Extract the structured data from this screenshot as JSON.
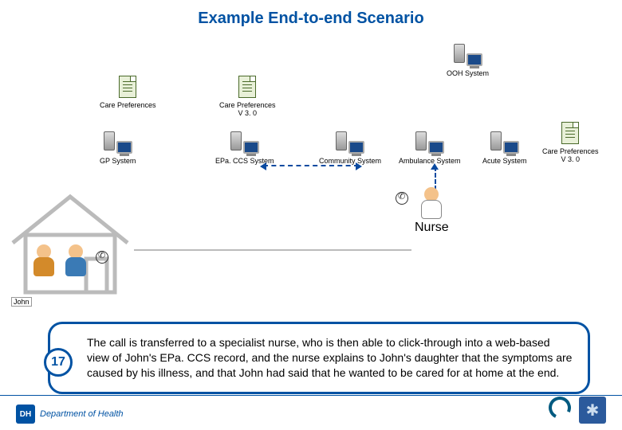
{
  "title": "Example End-to-end Scenario",
  "systems": {
    "ooh": "OOH System",
    "care_pref_left": "Care Preferences",
    "care_pref_mid": "Care Preferences\nV 3. 0",
    "gp": "GP System",
    "epaccs": "EPa. CCS System",
    "community": "Community System",
    "ambulance": "Ambulance System",
    "acute": "Acute System",
    "care_pref_right": "Care Preferences\nV 3. 0"
  },
  "john_label": "John",
  "nurse_label": "Nurse",
  "callout": {
    "num": "17",
    "text": "The call is transferred to a specialist nurse, who is then able to click-through into a web-based view of John's EPa. CCS record, and the nurse explains to John's daughter that the symptoms are caused by his illness, and that John had said that he wanted to be cared for at home at the end."
  },
  "logos": {
    "dh_initials": "DH",
    "dh_full": "Department of Health"
  }
}
